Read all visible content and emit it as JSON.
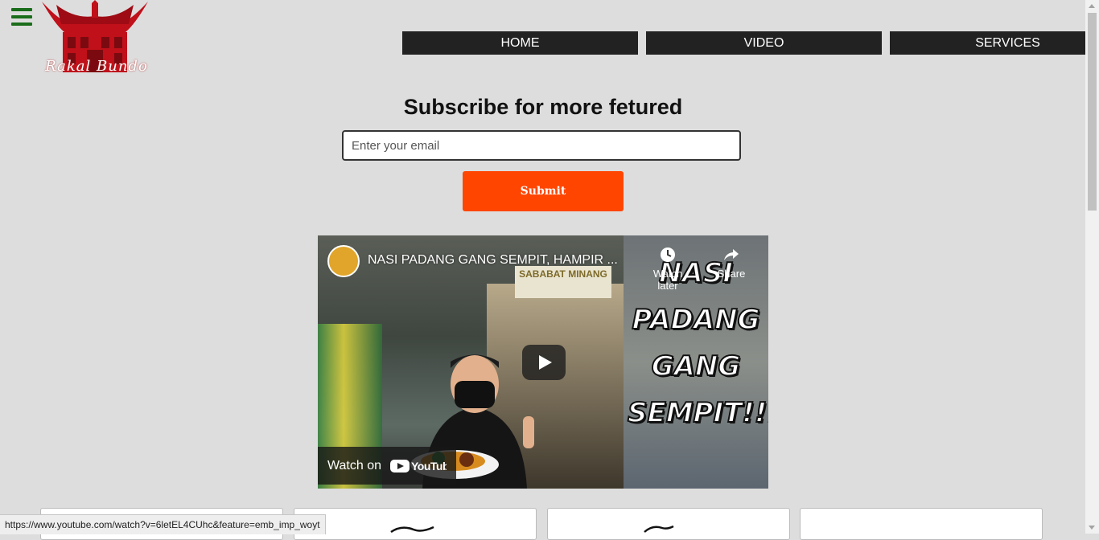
{
  "header": {
    "menu_icon": "hamburger-icon",
    "logo_text": "Rakal Bundo"
  },
  "nav": {
    "items": [
      {
        "label": "HOME"
      },
      {
        "label": "VIDEO"
      },
      {
        "label": "SERVICES"
      }
    ]
  },
  "subscribe": {
    "title": "Subscribe for more fetured",
    "email_placeholder": "Enter your email",
    "submit_label": "Submit"
  },
  "video": {
    "title": "NASI PADANG GANG SEMPIT, HAMPIR ...",
    "watch_later_label": "Watch later",
    "share_label": "Share",
    "watch_on_label": "Watch on",
    "youtube_label": "YouTube",
    "thumbnail_text": [
      "NASI",
      "PADANG",
      "GANG",
      "SEMPIT!!!"
    ],
    "sign_text": "SABABAT MINANG"
  },
  "status_bar": {
    "url": "https://www.youtube.com/watch?v=6letEL4CUhc&feature=emb_imp_woyt"
  },
  "colors": {
    "background": "#dddddd",
    "nav_bg": "#222222",
    "submit_bg": "#ff4500",
    "menu_icon": "#1a6d1a",
    "logo_red": "#c0101a"
  }
}
